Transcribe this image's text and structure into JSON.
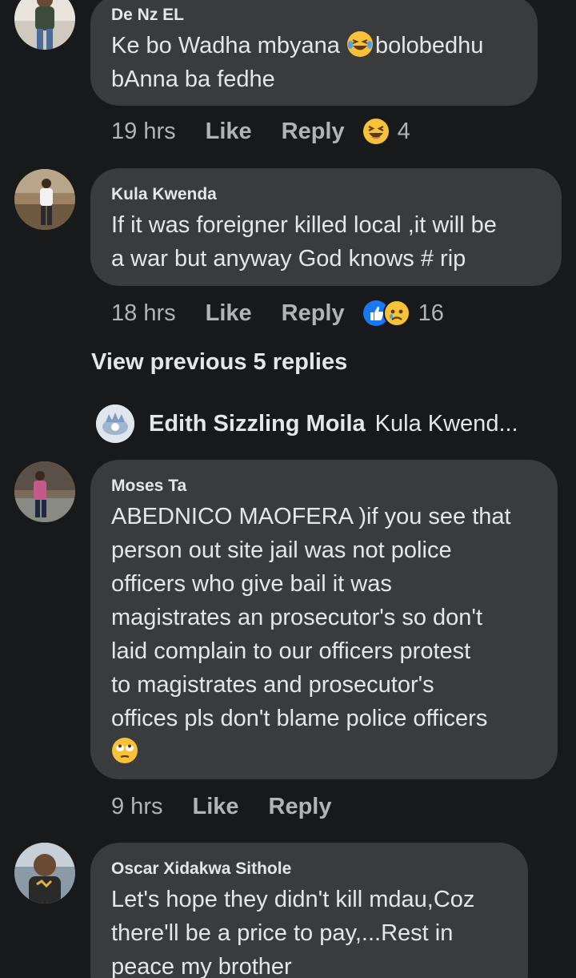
{
  "comments": [
    {
      "author": "De Nz EL",
      "line1_before_emoji": "Ke bo Wadha mbyana ",
      "line1_after_emoji": "bolobedhu",
      "line2": "bAnna ba fedhe",
      "time": "19 hrs",
      "like_label": "Like",
      "reply_label": "Reply",
      "reaction_icon": "haha-reaction-icon",
      "reaction_count": "4"
    },
    {
      "author": "Kula Kwenda",
      "lines": [
        "If it was foreigner killed local ,it will be",
        "a war but anyway God knows # rip"
      ],
      "time": "18 hrs",
      "like_label": "Like",
      "reply_label": "Reply",
      "reaction_icons": [
        "like-reaction-icon",
        "sad-reaction-icon"
      ],
      "reaction_count": "16"
    },
    {
      "author": "Moses Ta",
      "lines": [
        "ABEDNICO MAOFERA )if you see that",
        "person out site jail was not police",
        "officers who give bail it was",
        "magistrates an prosecutor's so don't",
        "laid complain to our officers protest",
        "to magistrates and prosecutor's",
        "offices pls don't blame police officers"
      ],
      "trailing_emoji": "eye-roll-emoji-icon",
      "time": "9 hrs",
      "like_label": "Like",
      "reply_label": "Reply"
    },
    {
      "author": "Oscar Xidakwa Sithole",
      "lines": [
        "Let's hope they didn't kill mdau,Coz",
        "there'll be a price to pay,...Rest in",
        "peace my brother"
      ]
    }
  ],
  "thread": {
    "view_previous_label": "View previous 5 replies",
    "latest_reply_author": "Edith Sizzling Moila",
    "latest_reply_preview": "Kula Kwend..."
  },
  "colors": {
    "background": "#18191a",
    "bubble": "#3a3b3c",
    "primary_text": "#e4e6eb",
    "secondary_text": "#b0b3b8",
    "like_blue": "#1877f2",
    "emoji_yellow": "#f7c237"
  }
}
